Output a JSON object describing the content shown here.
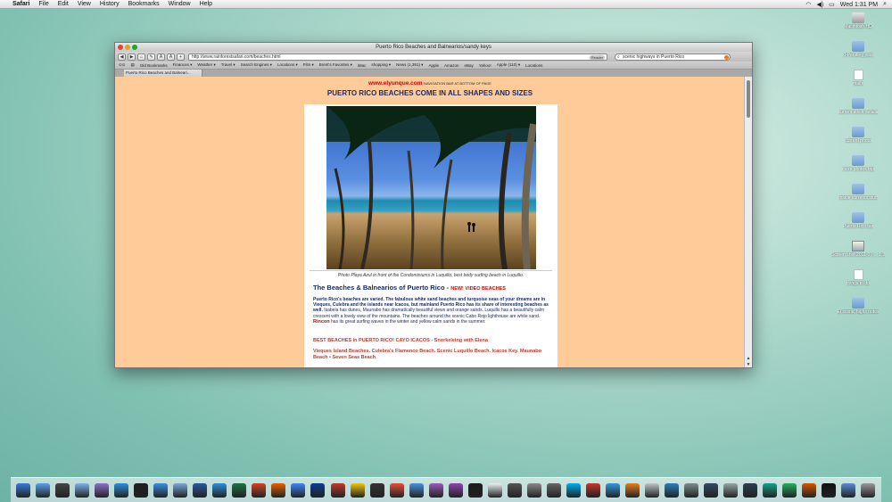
{
  "menubar": {
    "app": "Safari",
    "items": [
      "File",
      "Edit",
      "View",
      "History",
      "Bookmarks",
      "Window",
      "Help"
    ],
    "clock": "Wed 1:31 PM"
  },
  "desktop_icons": [
    {
      "label": "Macintosh HD",
      "kind": "disk"
    },
    {
      "label": "0-Pending jobs",
      "kind": "folder"
    },
    {
      "label": "mailx",
      "kind": "doc"
    },
    {
      "label": "current stock details",
      "kind": "folder"
    },
    {
      "label": "current photo",
      "kind": "folder"
    },
    {
      "label": "more photos trip",
      "kind": "folder"
    },
    {
      "label": "Inside currents stuff",
      "kind": "folder"
    },
    {
      "label": "Puerto Rico tax",
      "kind": "folder"
    },
    {
      "label": "Screen shot 2011-07-... 1:30 PM",
      "kind": "img"
    },
    {
      "label": "things to do",
      "kind": "doc"
    },
    {
      "label": "El scenic highs notes",
      "kind": "folder"
    }
  ],
  "window": {
    "title": "Puerto Rico Beaches and Balnearios/sandy keys",
    "url": "http://www.rainforestsafari.com/beaches.html",
    "reader": "Reader",
    "search": "scenic highways in Puerto Rico",
    "bookmarks": [
      "Old Bookmarks",
      "Finances ▾",
      "Weather ▾",
      "Travel ▾",
      "Search Engines ▾",
      "Locations ▾",
      "Film ▾",
      "Brent's Favorites ▾",
      "iMac",
      "shopping ▾",
      "News (1,391) ▾",
      "Apple",
      "Amazon",
      "eBay",
      "Yahoo!",
      "Apple (110) ▾",
      "Locations"
    ],
    "tab": "Puerto Rico Beaches and Balneari..."
  },
  "page": {
    "site": "www.elyunque.com",
    "nav_note": "NAVIGATION BAR AT BOTTOM OF PAGE",
    "headline": "PUERTO RICO BEACHES COME IN ALL SHAPES AND SIZES",
    "caption": "Photo Playa Azul in front of the Condominiums in Luquillo, best body surfing beach in Luquillo.",
    "section_title": "The Beaches & Balnearios of Puerto Rico",
    "section_new": "NEW! VIDEO BEACHES",
    "para_bold": "Puerto Rico's beaches are varied. The fabulous white sand beaches and turquoise seas of your dreams are in Vieques, Culebra and the islands near Icacos, but mainland Puerto Rico has its share of interesting beaches as well.",
    "para_rest": "Isabela has dunes, Maunabo has dramatically beautiful views and orange sands. Luquillo has a beautifully calm crescent with a lovely view of the mountains. The beaches around the scenic Cabo Rojo lighthouse are white sand.",
    "para_rincon": "Rincon",
    "para_end": "has its great surfing waves in the winter and yellow calm sands in the summer.",
    "best_line": "BEST BEACHES in PUERTO RICO! CAYO ICACOS - Snorkeleing with Elena",
    "vieques_line": "Vieques Island Beaches. Culebra's Flamenco Beach. Scenic Luquillo Beach. Icacos Key. Maunabo Beach • Seven Seas Beach"
  },
  "dock_apps": [
    "finder",
    "appstore",
    "dashboard",
    "facetime",
    "mission",
    "preview",
    "aol",
    "safari",
    "mail",
    "word",
    "wps",
    "excel",
    "powerpoint",
    "firefox",
    "chrome",
    "photoshop",
    "acrobat",
    "pages",
    "dvd",
    "calendar",
    "itunes",
    "music",
    "guitar",
    "quicktime",
    "textedit",
    "calculator",
    "system",
    "utility",
    "skype",
    "photobooth",
    "keynote",
    "scrapbook",
    "ipod",
    "messages",
    "sysprefs",
    "network",
    "wifi",
    "printer",
    "camera",
    "screenshot",
    "vm",
    "terminal",
    "folder",
    "trash"
  ]
}
